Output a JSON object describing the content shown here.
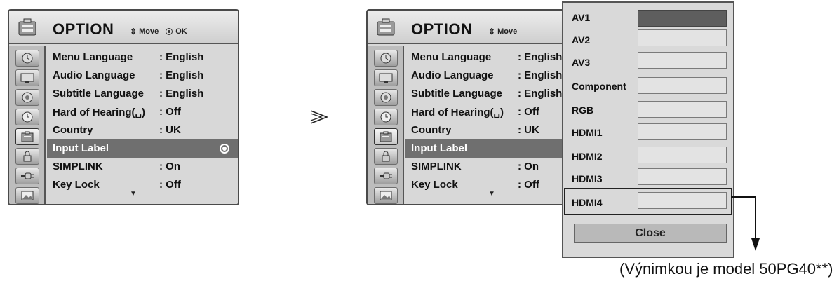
{
  "osd": {
    "title": "OPTION",
    "hint_move": "Move",
    "hint_ok": "OK",
    "sidebar_icons": [
      "clock-icon",
      "monitor-icon",
      "speaker-icon",
      "timer-icon",
      "option-icon",
      "lock-icon",
      "plug-icon",
      "photo-icon"
    ],
    "active_sidebar_icon": "option-icon",
    "items": [
      {
        "label": "Menu Language",
        "value": ": English"
      },
      {
        "label": "Audio Language",
        "value": ": English"
      },
      {
        "label": "Subtitle Language",
        "value": ": English"
      },
      {
        "label": "Hard of Hearing(␣)",
        "value": ": Off"
      },
      {
        "label": "Country",
        "value": ": UK"
      },
      {
        "label": "Input Label",
        "value": ""
      },
      {
        "label": "SIMPLINK",
        "value": ": On"
      },
      {
        "label": "Key Lock",
        "value": ": Off"
      }
    ],
    "selected_item": "Input Label"
  },
  "transition_glyph": "≳",
  "input_popup": {
    "sources": [
      "AV1",
      "AV2",
      "AV3",
      "Component",
      "RGB",
      "HDMI1",
      "HDMI2",
      "HDMI3",
      "HDMI4"
    ],
    "highlighted_source": "AV1",
    "outlined_source": "HDMI4",
    "close_label": "Close"
  },
  "footnote": "(Výnimkou je model 50PG40**)"
}
